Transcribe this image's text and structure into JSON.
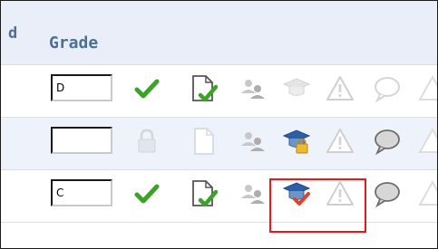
{
  "header": {
    "prev_column_fragment": "d",
    "grade_label": "Grade"
  },
  "rows": [
    {
      "grade_value": "D",
      "validated": true,
      "document_state": "submitted",
      "group_icon": "disabled",
      "grading_cap": "disabled",
      "warning": "disabled",
      "comment": "disabled"
    },
    {
      "grade_value": "",
      "validated": false,
      "locked": true,
      "document_state": "empty",
      "group_icon": "disabled",
      "grading_cap": "locked",
      "warning": "disabled",
      "comment": "active"
    },
    {
      "grade_value": "C",
      "validated": true,
      "document_state": "submitted",
      "group_icon": "disabled",
      "grading_cap": "graded",
      "warning": "disabled",
      "comment": "active"
    }
  ],
  "highlight": {
    "color": "#e8191c",
    "target_row": 3,
    "target": "grading-cap-and-warning-icons"
  },
  "colors": {
    "header_text": "#4a6f9a",
    "header_bg": "#e9eef8",
    "row_alt_bg": "#eef2fa",
    "check_green": "#3aa427",
    "cap_blue": "#2d5fa8"
  }
}
